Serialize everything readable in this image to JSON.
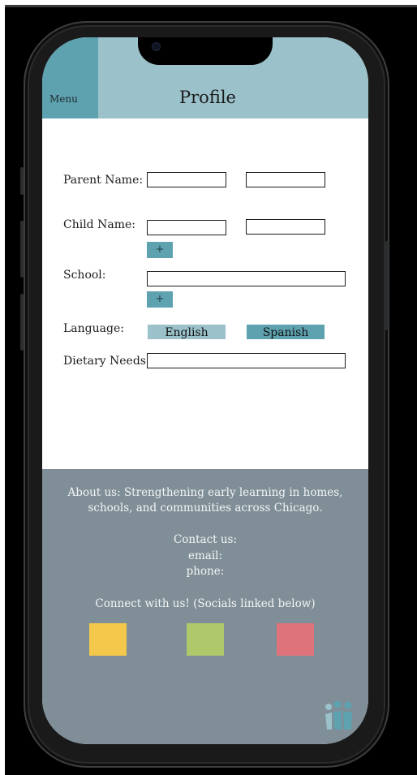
{
  "header": {
    "menu_label": "Menu",
    "title": "Profile"
  },
  "form": {
    "parent_name_label": "Parent Name:",
    "child_name_label": "Child Name:",
    "school_label": "School:",
    "language_label": "Language:",
    "dietary_label": "Dietary Needs:",
    "add_label": "+",
    "language_options": [
      "English",
      "Spanish"
    ],
    "inputs": {
      "parent_first": "",
      "parent_last": "",
      "child_first": "",
      "child_last": "",
      "school": "",
      "dietary": ""
    }
  },
  "footer": {
    "about_line1": "About us: Strengthening early learning in homes,",
    "about_line2": "schools, and communities across Chicago.",
    "contact_heading": "Contact us:",
    "email_label": "email:",
    "phone_label": "phone:",
    "connect_text": "Connect with us! (Socials linked below)",
    "socials": [
      {
        "color": "#f4c84a"
      },
      {
        "color": "#aec86a"
      },
      {
        "color": "#de737b"
      }
    ]
  },
  "colors": {
    "header_bg": "#9bc1ca",
    "accent": "#5ea2b0",
    "english_button": "#9bc1ca",
    "spanish_button": "#5ea2b0",
    "footer_bg": "#7f8e97"
  }
}
